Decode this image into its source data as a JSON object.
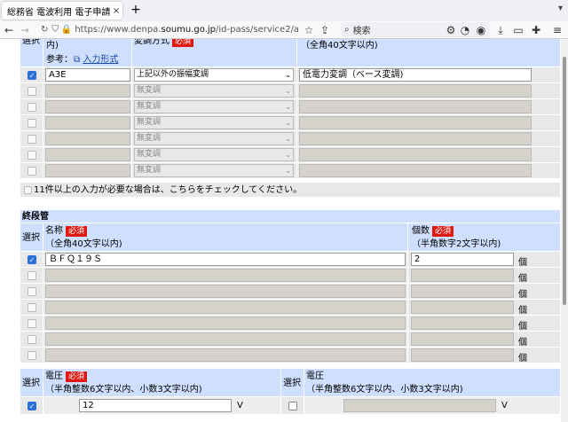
{
  "browser": {
    "tab_title": "総務省 電波利用 電子申請・",
    "tab_close": "×",
    "new_tab": "+",
    "url_prefix": "https://www.denpa.",
    "url_domain": "soumu.go.jp",
    "url_suffix": "/id-pass/service2/a",
    "search_placeholder": "検索"
  },
  "section1": {
    "col_select_label": "選択",
    "name_header_tail": "内)",
    "ref_label": "参考：",
    "input_format_link": "入力形式",
    "modulation_header": "変調方式",
    "required": "必須",
    "note_header": "（全角40文字以内)",
    "rows": [
      {
        "checked": true,
        "name": "A3E",
        "modulation": "上記以外の振幅変調",
        "note": "低電力変調（ベース変調)"
      },
      {
        "checked": false,
        "name": "",
        "modulation": "無変調",
        "note": ""
      },
      {
        "checked": false,
        "name": "",
        "modulation": "無変調",
        "note": ""
      },
      {
        "checked": false,
        "name": "",
        "modulation": "無変調",
        "note": ""
      },
      {
        "checked": false,
        "name": "",
        "modulation": "無変調",
        "note": ""
      },
      {
        "checked": false,
        "name": "",
        "modulation": "無変調",
        "note": ""
      },
      {
        "checked": false,
        "name": "",
        "modulation": "無変調",
        "note": ""
      }
    ],
    "more_than_11": "11件以上の入力が必要な場合は、こちらをチェックしてください。"
  },
  "section2": {
    "title": "終段管",
    "col_select_label": "選択",
    "name_label": "名称",
    "required": "必須",
    "name_hint": "（全角40文字以内)",
    "count_label": "個数",
    "count_hint": "（半角数字2文字以内)",
    "unit": "個",
    "rows": [
      {
        "checked": true,
        "name": "ＢＦＱ１９Ｓ",
        "count": "2"
      },
      {
        "checked": false,
        "name": "",
        "count": ""
      },
      {
        "checked": false,
        "name": "",
        "count": ""
      },
      {
        "checked": false,
        "name": "",
        "count": ""
      },
      {
        "checked": false,
        "name": "",
        "count": ""
      },
      {
        "checked": false,
        "name": "",
        "count": ""
      },
      {
        "checked": false,
        "name": "",
        "count": ""
      }
    ]
  },
  "section3": {
    "col_select_label": "選択",
    "voltage_label": "電圧",
    "required": "必須",
    "voltage_hint": "（半角整数6文字以内、小数3文字以内)",
    "unit": "V",
    "left_value": "12",
    "left_checked": true,
    "right_value": "",
    "right_checked": false
  }
}
